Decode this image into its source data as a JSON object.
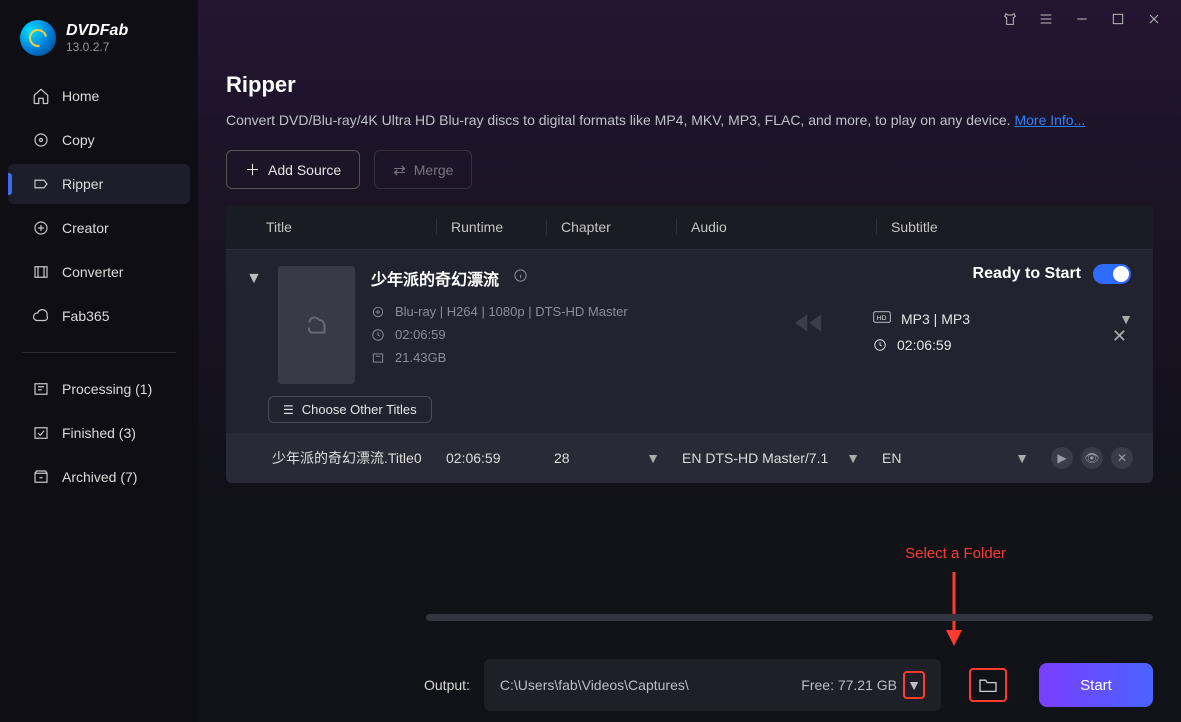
{
  "brand": {
    "name": "DVDFab",
    "version": "13.0.2.7"
  },
  "sidebar": {
    "items": [
      {
        "label": "Home"
      },
      {
        "label": "Copy"
      },
      {
        "label": "Ripper"
      },
      {
        "label": "Creator"
      },
      {
        "label": "Converter"
      },
      {
        "label": "Fab365"
      }
    ],
    "status_items": [
      {
        "label": "Processing (1)"
      },
      {
        "label": "Finished (3)"
      },
      {
        "label": "Archived (7)"
      }
    ]
  },
  "page": {
    "title": "Ripper",
    "description": "Convert DVD/Blu-ray/4K Ultra HD Blu-ray discs to digital formats like MP4, MKV, MP3, FLAC, and more, to play on any device. ",
    "more_info": "More Info...",
    "add_source": "Add Source",
    "merge": "Merge"
  },
  "table": {
    "headers": {
      "title": "Title",
      "runtime": "Runtime",
      "chapter": "Chapter",
      "audio": "Audio",
      "subtitle": "Subtitle"
    }
  },
  "item": {
    "title": "少年派的奇幻漂流",
    "format_line": "Blu-ray | H264 | 1080p | DTS-HD Master",
    "duration": "02:06:59",
    "size": "21.43GB",
    "status": "Ready to Start",
    "output_format": "MP3 | MP3",
    "output_duration": "02:06:59",
    "other_titles": "Choose Other Titles"
  },
  "subrow": {
    "title": "少年派的奇幻漂流.Title0",
    "runtime": "02:06:59",
    "chapter": "28",
    "audio": "EN  DTS-HD Master/7.1",
    "subtitle": "EN"
  },
  "annotation": {
    "text": "Select a Folder"
  },
  "output": {
    "label": "Output:",
    "path": "C:\\Users\\fab\\Videos\\Captures\\",
    "free": "Free: 77.21 GB"
  },
  "start": "Start"
}
